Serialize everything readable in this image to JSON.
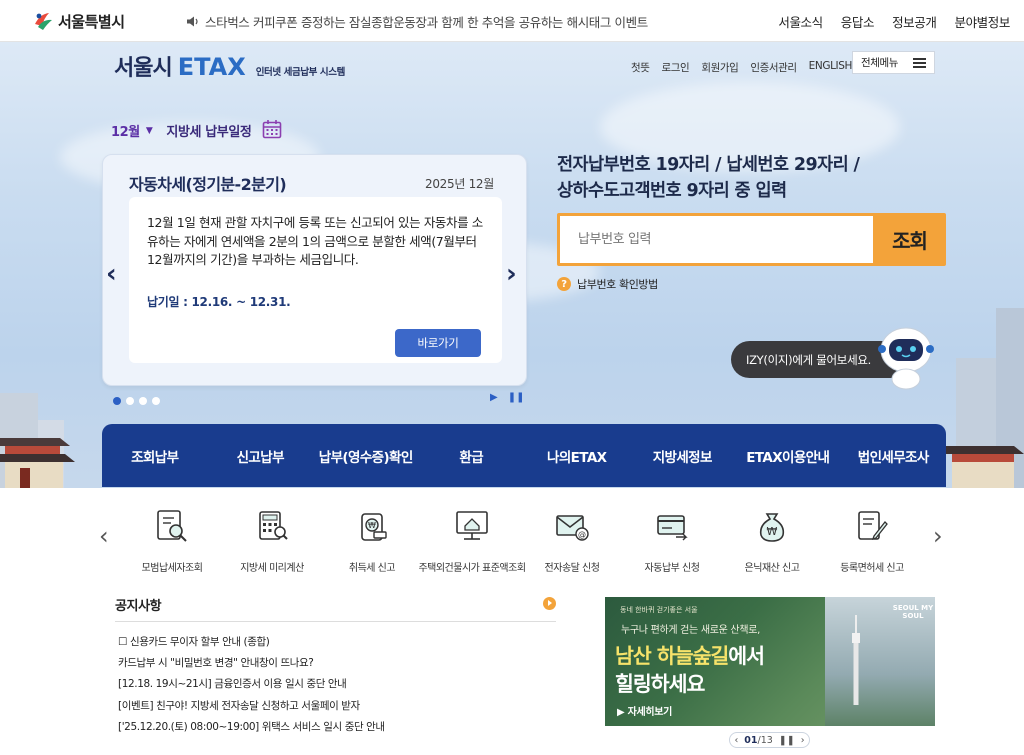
{
  "gov": {
    "logo_text": "서울특별시",
    "notice": "스타벅스 커피쿠폰 증정하는 잠실종합운동장과 함께 한 추억을 공유하는 해시태그 이벤트",
    "links": [
      "서울소식",
      "응답소",
      "정보공개",
      "분야별정보"
    ]
  },
  "etax": {
    "logo_main": "서울시",
    "logo_accent": "ETAX",
    "logo_sub": "인터넷 세금납부 시스템",
    "util_links": [
      "첫뜻",
      "로그인",
      "회원가입",
      "인증서관리",
      "ENGLISH"
    ],
    "all_menu_label": "전체메뉴"
  },
  "schedule": {
    "month": "12월",
    "title": "지방세 납부일정",
    "card": {
      "title": "자동차세(정기분-2분기)",
      "date": "2025년 12월",
      "description": "12월 1일 현재 관할 자치구에 등록 또는 신고되어 있는 자동차를 소유하는 자에게 연세액을 2분의 1의 금액으로 분할한 세액(7월부터 12월까지의 기간)을 부과하는 세금입니다.",
      "due": "납기일 : 12.16. ~ 12.31.",
      "button": "바로가기"
    }
  },
  "search": {
    "title_line1": "전자납부번호 19자리 / 납세번호 29자리 /",
    "title_line2": "상하수도고객번호 9자리 중 입력",
    "placeholder": "납부번호 입력",
    "button": "조회",
    "help": "납부번호 확인방법"
  },
  "chatbot": {
    "label": "IZY(이지)에게 물어보세요."
  },
  "main_nav": [
    "조회납부",
    "신고납부",
    "납부(영수증)확인",
    "환급",
    "나의ETAX",
    "지방세정보",
    "ETAX이용안내",
    "법인세무조사"
  ],
  "quick_menu": [
    {
      "label": "모범납세자조회",
      "icon": "certificate-search-icon"
    },
    {
      "label": "지방세 미리계산",
      "icon": "tax-calculator-icon"
    },
    {
      "label": "취득세 신고",
      "icon": "won-pouch-icon"
    },
    {
      "label": "주택외건물시가 표준액조회",
      "icon": "house-monitor-icon"
    },
    {
      "label": "전자송달 신청",
      "icon": "email-icon"
    },
    {
      "label": "자동납부 신청",
      "icon": "card-transfer-icon"
    },
    {
      "label": "은닉재산 신고",
      "icon": "money-bag-icon"
    },
    {
      "label": "등록면허세 신고",
      "icon": "document-pen-icon"
    }
  ],
  "notices": {
    "title": "공지사항",
    "items": [
      "☐ 신용카드 무이자 할부 안내 (종합)",
      "카드납부 시 \"비밀번호 변경\" 안내창이 뜨나요?",
      "[12.18. 19시~21시] 금융인증서 이용 일시 중단 안내",
      "[이벤트] 친구야! 지방세 전자송달 신청하고 서울페이 받자",
      "['25.12.20.(토) 08:00~19:00] 위택스 서비스 일시 중단 안내"
    ]
  },
  "banner": {
    "small": "동네 한바퀴 걷기좋은 서울",
    "sub": "누구나 편하게 걷는 새로운 산책로,",
    "title_a": "남산 하늘숲길",
    "title_b": "에서",
    "title_c": "힐링하세요",
    "button": "▶ 자세히보기",
    "logo": "SEOUL MY SOUL",
    "page_current": "01",
    "page_total": "/13"
  }
}
